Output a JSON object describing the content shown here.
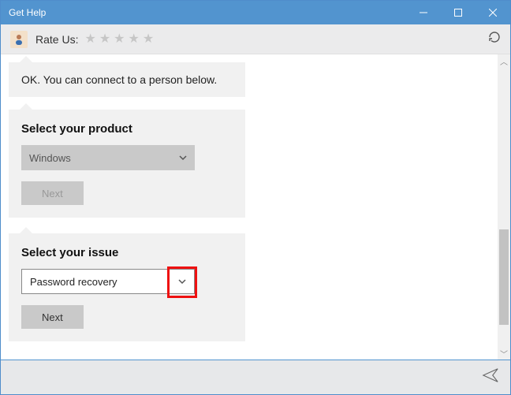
{
  "window": {
    "title": "Get Help"
  },
  "toolbar": {
    "rate_label": "Rate Us:"
  },
  "chat": {
    "msg1": "OK. You can connect to a person below."
  },
  "product_panel": {
    "heading": "Select your product",
    "selected": "Windows",
    "next_label": "Next"
  },
  "issue_panel": {
    "heading": "Select your issue",
    "selected": "Password recovery",
    "next_label": "Next"
  }
}
